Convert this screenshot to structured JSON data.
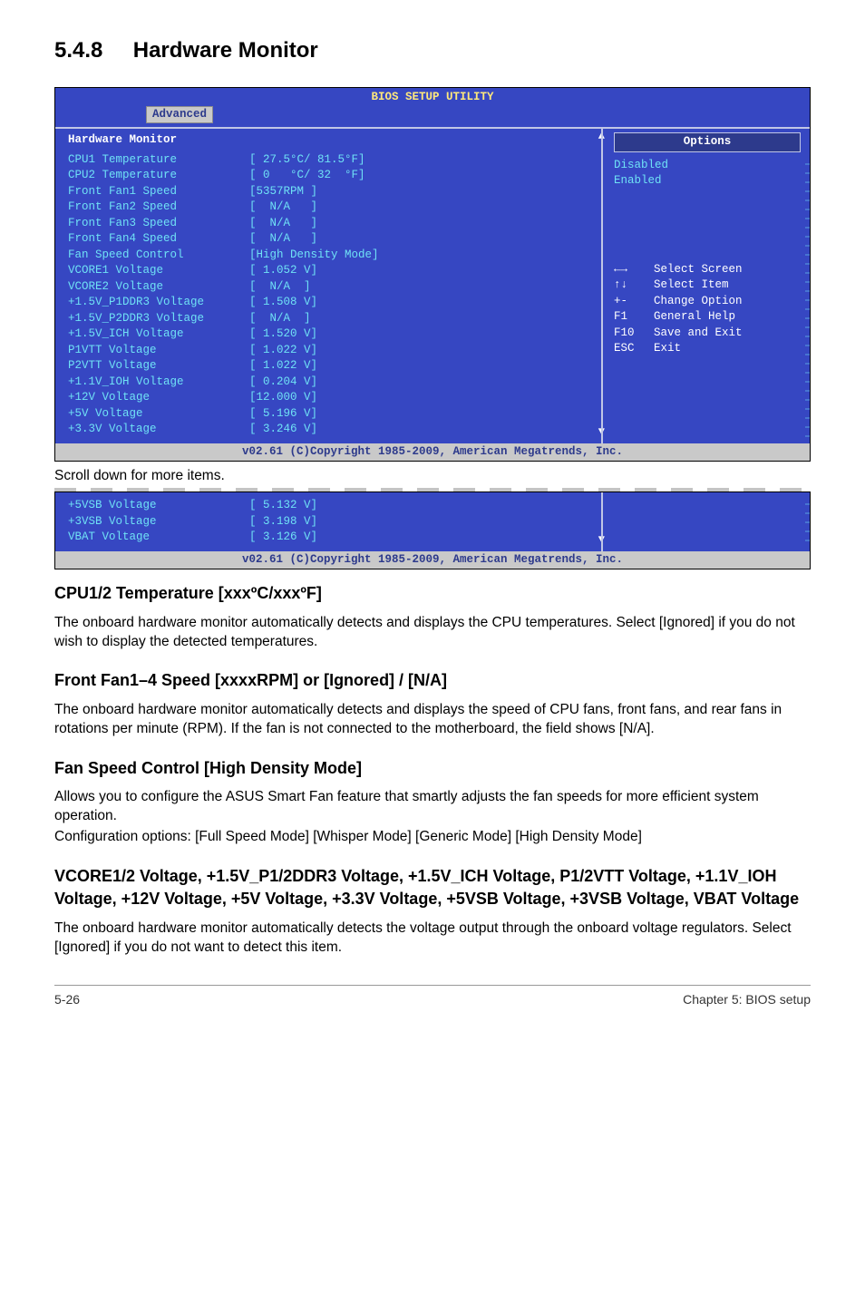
{
  "section_number": "5.4.8",
  "section_title": "Hardware Monitor",
  "bios1": {
    "header": "BIOS SETUP UTILITY",
    "tab": "Advanced",
    "group_title": "Hardware Monitor",
    "lines": [
      {
        "label": "CPU1 Temperature",
        "value": "[ 27.5°C/ 81.5°F]"
      },
      {
        "label": "CPU2 Temperature",
        "value": "[ 0   °C/ 32  °F]"
      },
      {
        "label": "Front Fan1 Speed",
        "value": "[5357RPM ]"
      },
      {
        "label": "Front Fan2 Speed",
        "value": "[  N/A   ]"
      },
      {
        "label": "Front Fan3 Speed",
        "value": "[  N/A   ]"
      },
      {
        "label": "Front Fan4 Speed",
        "value": "[  N/A   ]"
      },
      {
        "label": "Fan Speed Control",
        "value": "[High Density Mode]"
      },
      {
        "label": "VCORE1 Voltage",
        "value": "[ 1.052 V]"
      },
      {
        "label": "VCORE2 Voltage",
        "value": "[  N/A  ]"
      },
      {
        "label": "+1.5V_P1DDR3 Voltage",
        "value": "[ 1.508 V]"
      },
      {
        "label": "+1.5V_P2DDR3 Voltage",
        "value": "[  N/A  ]"
      },
      {
        "label": "+1.5V_ICH Voltage",
        "value": "[ 1.520 V]"
      },
      {
        "label": "P1VTT Voltage",
        "value": "[ 1.022 V]"
      },
      {
        "label": "P2VTT Voltage",
        "value": "[ 1.022 V]"
      },
      {
        "label": "+1.1V_IOH Voltage",
        "value": "[ 0.204 V]"
      },
      {
        "label": "+12V Voltage",
        "value": "[12.000 V]"
      },
      {
        "label": "+5V Voltage",
        "value": "[ 5.196 V]"
      },
      {
        "label": "+3.3V Voltage",
        "value": "[ 3.246 V]"
      }
    ],
    "options_header": "Options",
    "options": [
      "Disabled",
      "Enabled"
    ],
    "help": [
      {
        "key": "←→",
        "act": "Select Screen"
      },
      {
        "key": "↑↓",
        "act": "Select Item"
      },
      {
        "key": "+-",
        "act": "Change Option"
      },
      {
        "key": "F1",
        "act": "General Help"
      },
      {
        "key": "F10",
        "act": "Save and Exit"
      },
      {
        "key": "ESC",
        "act": "Exit"
      }
    ],
    "copyright": "v02.61 (C)Copyright 1985-2009, American Megatrends, Inc."
  },
  "scroll_note": "Scroll down for more items.",
  "bios2": {
    "lines": [
      {
        "label": "+5VSB Voltage",
        "value": "[ 5.132 V]"
      },
      {
        "label": "+3VSB Voltage",
        "value": "[ 3.198 V]"
      },
      {
        "label": "VBAT Voltage",
        "value": "[ 3.126 V]"
      }
    ],
    "copyright": "v02.61 (C)Copyright 1985-2009, American Megatrends, Inc."
  },
  "h1": "CPU1/2 Temperature [xxxºC/xxxºF]",
  "p1": "The onboard hardware monitor automatically detects and displays the CPU temperatures. Select [Ignored] if you do not wish to display the detected temperatures.",
  "h2": "Front Fan1–4 Speed [xxxxRPM] or [Ignored] / [N/A]",
  "p2": "The onboard hardware monitor automatically detects and displays the speed of CPU fans, front fans, and rear fans in rotations per minute (RPM). If the fan is not connected to the motherboard, the field shows [N/A].",
  "h3": "Fan Speed Control [High Density Mode]",
  "p3a": "Allows you to configure the ASUS Smart Fan feature that smartly adjusts the fan speeds for more efficient system operation.",
  "p3b": "Configuration options: [Full Speed Mode] [Whisper Mode] [Generic Mode] [High Density Mode]",
  "h4": "VCORE1/2 Voltage, +1.5V_P1/2DDR3 Voltage, +1.5V_ICH Voltage, P1/2VTT Voltage, +1.1V_IOH Voltage, +12V Voltage, +5V Voltage, +3.3V Voltage, +5VSB Voltage, +3VSB Voltage, VBAT Voltage",
  "p4": "The onboard hardware monitor automatically detects the voltage output through the onboard voltage regulators. Select [Ignored] if you do not want to detect this item.",
  "footer_left": "5-26",
  "footer_right": "Chapter 5: BIOS setup"
}
